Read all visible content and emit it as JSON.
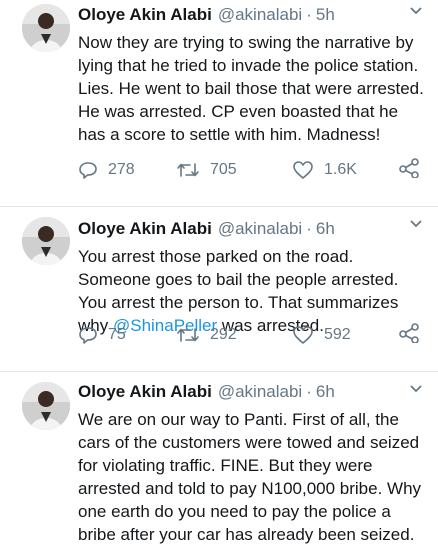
{
  "tweets": [
    {
      "name": "Oloye Akin Alabi",
      "handle": "@akinalabi",
      "separator": "·",
      "time": "5h",
      "text": "Now they are trying to swing the narrative by lying that he tried to invade the police station. Lies. He went to bail those that were arrested. He was arrested. CP even boasted that he has a score to settle with him. Madness!",
      "replies": "278",
      "retweets": "705",
      "likes": "1.6K"
    },
    {
      "name": "Oloye Akin Alabi",
      "handle": "@akinalabi",
      "separator": "·",
      "time": "6h",
      "text_before": "You arrest those parked on the road. Someone goes to bail the people arrested. You arrest the person to. That summarizes why ",
      "mention": "@ShinaPeller",
      "text_after": " was arrested.",
      "replies": "75",
      "retweets": "292",
      "likes": "592"
    },
    {
      "name": "Oloye Akin Alabi",
      "handle": "@akinalabi",
      "separator": "·",
      "time": "6h",
      "text": "We are on our way to Panti. First of all, the cars of the customers were towed and seized for violating traffic. FINE. But they were arrested and told to pay N100,000 bribe. Why one earth do you need to pay the police a bribe after your car has already been seized."
    }
  ],
  "icons": {
    "reply": "reply-icon",
    "retweet": "retweet-icon",
    "like": "heart-icon",
    "share": "share-icon",
    "menu": "chevron-down-icon"
  },
  "colors": {
    "text": "#14171a",
    "muted": "#657786",
    "link": "#1b95e0",
    "divider": "#e1e8ed"
  }
}
